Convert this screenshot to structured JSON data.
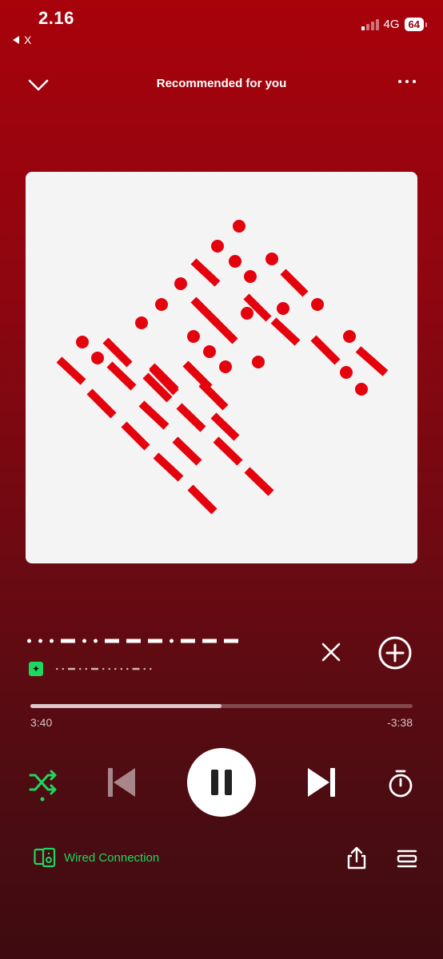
{
  "status_bar": {
    "time": "2.16",
    "back_app_label": "X",
    "network": "4G",
    "battery": "64"
  },
  "header": {
    "title": "Recommended for you"
  },
  "track": {
    "title_obscured": "• • • — • • — — — • — — —",
    "subtitle_obscured": "· · — · · — · · · · · — · ·"
  },
  "progress": {
    "elapsed": "3:40",
    "remaining": "-3:38",
    "fraction": 0.5
  },
  "playback": {
    "state": "playing",
    "shuffle_active": true
  },
  "device": {
    "label": "Wired Connection"
  },
  "colors": {
    "accent_green": "#1ed760",
    "background_top": "#a8020b",
    "background_bottom": "#3f0b10",
    "art_pattern": "#e4020d"
  },
  "icons": [
    "chevron-down-icon",
    "more-icon",
    "sparkle-icon",
    "close-icon",
    "add-icon",
    "shuffle-icon",
    "previous-icon",
    "pause-icon",
    "next-icon",
    "sleep-timer-icon",
    "device-icon",
    "share-icon",
    "queue-icon"
  ]
}
